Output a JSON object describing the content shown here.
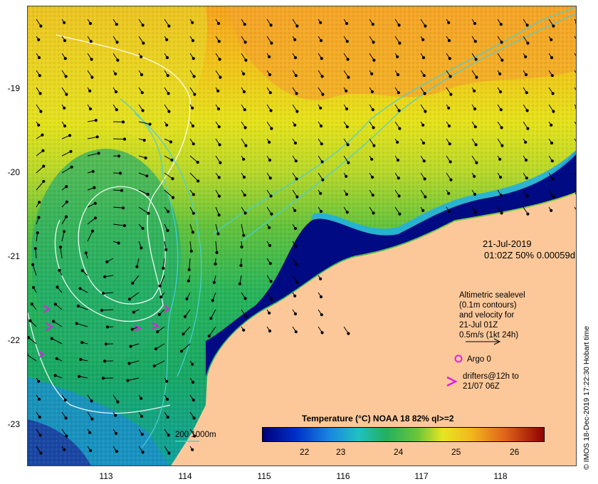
{
  "map": {
    "date": "21-Jul-2019",
    "time_line": "01:02Z  50% 0.00059d",
    "credit": "© IMOS 18-Dec-2019 17:22:30 Hobart time",
    "x_ticks": [
      "113",
      "114",
      "115",
      "116",
      "117",
      "118"
    ],
    "y_ticks": [
      "-19",
      "-20",
      "-21",
      "-22",
      "-23"
    ],
    "lon_range": [
      112.0,
      119.0
    ],
    "lat_range": [
      -23.5,
      -18.0
    ],
    "legend": {
      "line1": "Altimetric sealevel",
      "line2": "(0.1m contours)",
      "line3": "and velocity for",
      "line4": "21-Jul 01Z",
      "line5": "0.5m/s (1kt 24h)",
      "argo": "Argo 0",
      "drifters1": "drifters@12h to",
      "drifters2": "21/07 06Z"
    },
    "isobath_label": "200  1000m",
    "colorbar": {
      "title": "Temperature (°C) NOAA 18 82% ql>=2",
      "ticks": [
        "22",
        "23",
        "24",
        "25",
        "26"
      ],
      "min": 21.5,
      "max": 26.5
    },
    "colors": {
      "land": "#fcc89a",
      "cold": "#000080",
      "warm_orange": "#f39c1c",
      "argo": "#e020e0",
      "contour": "#ffffff",
      "isobath": "#46d0d8"
    }
  }
}
